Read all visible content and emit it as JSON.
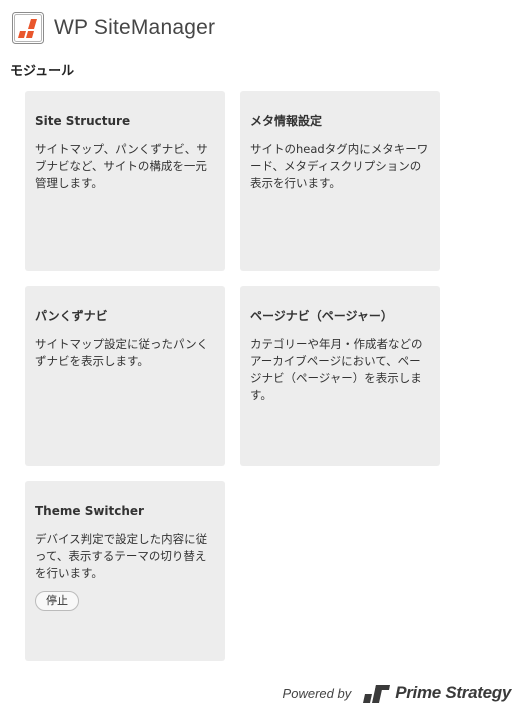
{
  "header": {
    "title": "WP SiteManager",
    "logo_icon": "wp-sitemanager-logo-icon",
    "logo_colors": {
      "frame": "#8c8c8c",
      "fill": "#e9562c"
    }
  },
  "section": {
    "title": "モジュール"
  },
  "modules": [
    {
      "title": "Site Structure",
      "desc": "サイトマップ、パンくずナビ、サブナビなど、サイトの構成を一元管理します。"
    },
    {
      "title": "メタ情報設定",
      "desc": "サイトのheadタグ内にメタキーワード、メタディスクリプションの表示を行います。"
    },
    {
      "title": "パンくずナビ",
      "desc": "サイトマップ設定に従ったパンくずナビを表示します。"
    },
    {
      "title": "ページナビ（ページャー）",
      "desc": "カテゴリーや年月・作成者などのアーカイブページにおいて、ページナビ（ページャー）を表示します。"
    },
    {
      "title": "Theme Switcher",
      "desc": "デバイス判定で設定した内容に従って、表示するテーマの切り替えを行います。",
      "button_label": "停止"
    }
  ],
  "footer": {
    "powered_by": "Powered by",
    "brand": "Prime Strategy",
    "brand_icon": "prime-strategy-logo-icon"
  }
}
